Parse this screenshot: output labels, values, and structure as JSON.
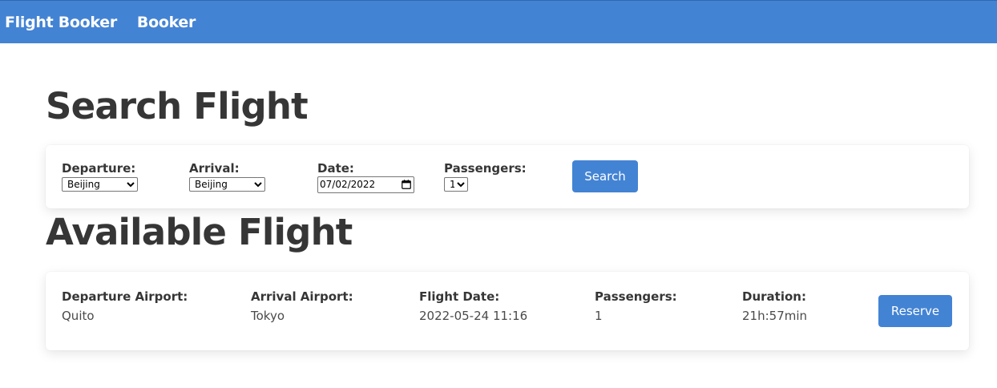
{
  "navbar": {
    "brand": "Flight Booker",
    "link": "Booker"
  },
  "search_section": {
    "title": "Search Flight",
    "departure": {
      "label": "Departure:",
      "value": "Beijing",
      "options": [
        "Beijing"
      ]
    },
    "arrival": {
      "label": "Arrival:",
      "value": "Beijing",
      "options": [
        "Beijing"
      ]
    },
    "date": {
      "label": "Date:",
      "value": "07/02/2022"
    },
    "passengers": {
      "label": "Passengers:",
      "value": "1",
      "options": [
        "1"
      ]
    },
    "search_label": "Search"
  },
  "results_section": {
    "title": "Available Flight",
    "flights": [
      {
        "departure_label": "Departure Airport:",
        "departure_value": "Quito",
        "arrival_label": "Arrival Airport:",
        "arrival_value": "Tokyo",
        "date_label": "Flight Date:",
        "date_value": "2022-05-24 11:16",
        "passengers_label": "Passengers:",
        "passengers_value": "1",
        "duration_label": "Duration:",
        "duration_value": "21h:57min",
        "reserve_label": "Reserve"
      }
    ]
  },
  "colors": {
    "primary": "#4383d4",
    "text": "#363636"
  }
}
